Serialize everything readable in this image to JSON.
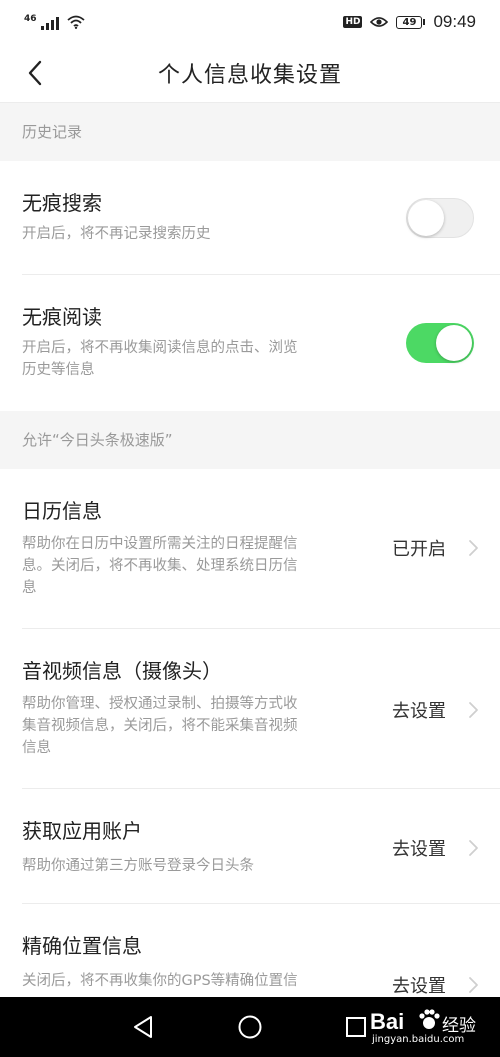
{
  "status_bar": {
    "network_label": "46",
    "hd_label": "HD",
    "battery": "49",
    "time": "09:49"
  },
  "nav": {
    "title": "个人信息收集设置",
    "back_icon": "chevron-left-icon"
  },
  "sections": [
    {
      "header": "历史记录"
    },
    {
      "header": "允许“今日头条极速版”"
    }
  ],
  "history": {
    "incognito_search": {
      "title": "无痕搜索",
      "desc": "开启后，将不再记录搜索历史",
      "enabled": false
    },
    "incognito_read": {
      "title": "无痕阅读",
      "desc_line1": "开启后，将不再收集阅读信息的点击、浏览",
      "desc_line2": "历史等信息",
      "enabled": true
    }
  },
  "permissions": {
    "calendar": {
      "title": "日历信息",
      "desc_line1": "帮助你在日历中设置所需关注的日程提醒信",
      "desc_line2": "息。关闭后，将不再收集、处理系统日历信",
      "desc_line3": "息",
      "status": "已开启"
    },
    "camera": {
      "title": "音视频信息（摄像头）",
      "desc_line1": "帮助你管理、授权通过录制、拍摄等方式收",
      "desc_line2": "集音视频信息，关闭后，将不能采集音视频",
      "desc_line3": "信息",
      "status": "去设置"
    },
    "accounts": {
      "title": "获取应用账户",
      "desc_line1": "帮助你通过第三方账号登录今日头条",
      "status": "去设置"
    },
    "location": {
      "title": "精确位置信息",
      "desc_line1": "关闭后，将不再收集你的GPS等精确位置信",
      "status": "去设置"
    }
  },
  "colors": {
    "toggle_on": "#4cd964",
    "toggle_off": "#f0f0f0",
    "section_bg": "#f5f5f5",
    "desc_text": "#9a9a9a"
  },
  "watermark": {
    "brand": "Bai",
    "suffix": "经验",
    "url": "jingyan.baidu.com"
  }
}
